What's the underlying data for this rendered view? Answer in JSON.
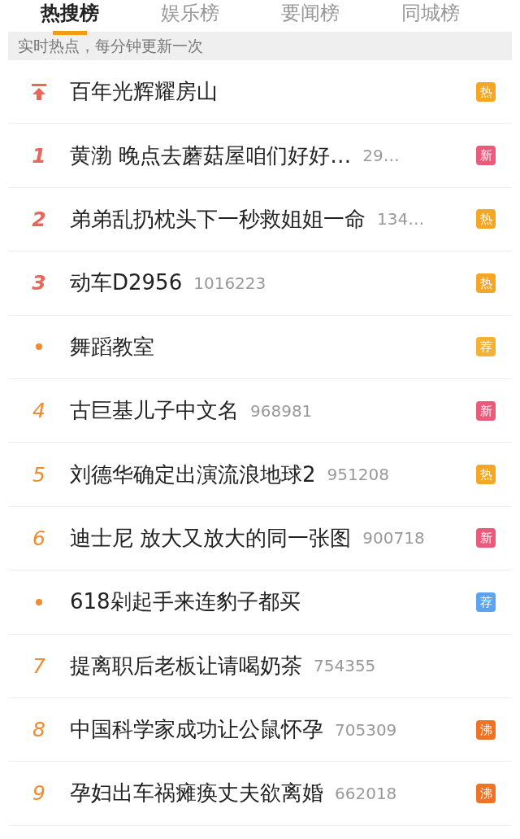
{
  "tabs": [
    {
      "label": "热搜榜",
      "selected": true
    },
    {
      "label": "娱乐榜",
      "selected": false
    },
    {
      "label": "要闻榜",
      "selected": false
    },
    {
      "label": "同城榜",
      "selected": false
    }
  ],
  "notice": "实时热点，每分钟更新一次",
  "items": [
    {
      "rank": {
        "kind": "top",
        "color": "#e8665a"
      },
      "title": "百年光辉耀房山",
      "badge": {
        "label": "热",
        "color": "#f5a623"
      }
    },
    {
      "rank": {
        "kind": "number",
        "text": "1",
        "color": "#e8665a"
      },
      "title": "黄渤 晚点去蘑菇屋咱们好好…",
      "count": "29…",
      "badge": {
        "label": "新",
        "color": "#ea5b7b"
      }
    },
    {
      "rank": {
        "kind": "number",
        "text": "2",
        "color": "#e8665a"
      },
      "title": "弟弟乱扔枕头下一秒救姐姐一命",
      "count": "134…",
      "badge": {
        "label": "热",
        "color": "#f5a623"
      }
    },
    {
      "rank": {
        "kind": "number",
        "text": "3",
        "color": "#e8665a"
      },
      "title": "动车D2956",
      "count": "1016223",
      "badge": {
        "label": "热",
        "color": "#f5a623"
      }
    },
    {
      "rank": {
        "kind": "dot",
        "color": "#f28a2f"
      },
      "title": "舞蹈教室",
      "badge": {
        "label": "荐",
        "color": "#f6b133"
      }
    },
    {
      "rank": {
        "kind": "number",
        "text": "4",
        "color": "#f28a2f"
      },
      "title": "古巨基儿子中文名",
      "count": "968981",
      "badge": {
        "label": "新",
        "color": "#ea5b7b"
      }
    },
    {
      "rank": {
        "kind": "number",
        "text": "5",
        "color": "#f28a2f"
      },
      "title": "刘德华确定出演流浪地球2",
      "count": "951208",
      "badge": {
        "label": "热",
        "color": "#f5a623"
      }
    },
    {
      "rank": {
        "kind": "number",
        "text": "6",
        "color": "#f28a2f"
      },
      "title": "迪士尼 放大又放大的同一张图",
      "count": "900718",
      "badge": {
        "label": "新",
        "color": "#ea5b7b"
      }
    },
    {
      "rank": {
        "kind": "dot",
        "color": "#f28a2f"
      },
      "title": "618剁起手来连豹子都买",
      "badge": {
        "label": "荐",
        "color": "#5ba4ef"
      }
    },
    {
      "rank": {
        "kind": "number",
        "text": "7",
        "color": "#f28a2f"
      },
      "title": "提离职后老板让请喝奶茶",
      "count": "754355"
    },
    {
      "rank": {
        "kind": "number",
        "text": "8",
        "color": "#f28a2f"
      },
      "title": "中国科学家成功让公鼠怀孕",
      "count": "705309",
      "badge": {
        "label": "沸",
        "color": "#f07224"
      }
    },
    {
      "rank": {
        "kind": "number",
        "text": "9",
        "color": "#f28a2f"
      },
      "title": "孕妇出车祸瘫痪丈夫欲离婚",
      "count": "662018",
      "badge": {
        "label": "沸",
        "color": "#f07224"
      }
    }
  ]
}
